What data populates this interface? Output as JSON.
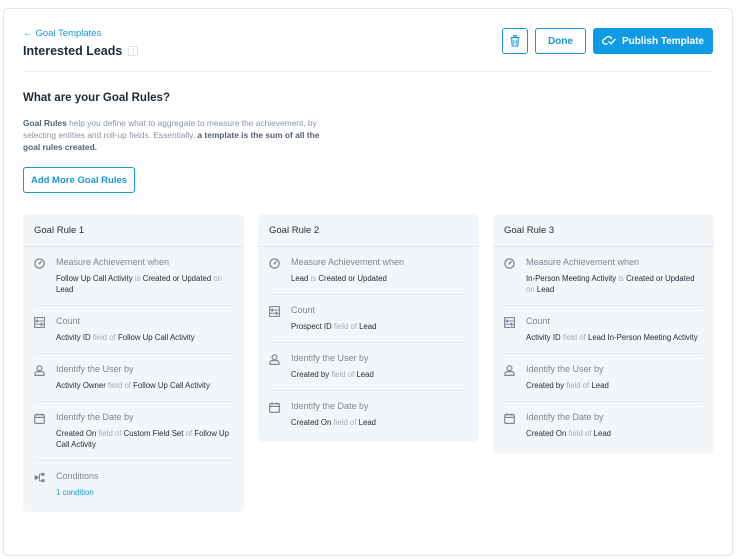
{
  "header": {
    "back_link": "Goal Templates",
    "back_arrow": "←",
    "title": "Interested Leads",
    "buttons": {
      "delete_icon": "trash-icon",
      "done": "Done",
      "publish": "Publish Template",
      "publish_icon": "cloud-check-icon"
    }
  },
  "intro": {
    "heading": "What are your Goal Rules?",
    "desc_bold_1": "Goal Rules",
    "desc_text_1": " help you define what to aggregate to measure the achievement, by selecting entities and roll-up fields. Essentially, ",
    "desc_bold_2": "a template is the sum of all the goal rules created.",
    "add_button": "Add More Goal Rules"
  },
  "labels": {
    "measure": "Measure Achievement when",
    "count": "Count",
    "user": "Identify the User by",
    "date": "Identify the Date by",
    "conditions": "Conditions",
    "is": "is",
    "on": "on",
    "field_of": "field of",
    "of": "of"
  },
  "rules": [
    {
      "title": "Goal Rule 1",
      "measure": {
        "entity": "Follow Up Call Activity",
        "action": "Created or Updated",
        "on": "Lead"
      },
      "count": {
        "field": "Activity ID",
        "of": "Follow Up Call Activity"
      },
      "user": {
        "field": "Activity Owner",
        "of": "Follow Up Call Activity"
      },
      "date": {
        "field": "Created On",
        "of": "Custom Field Set",
        "of2": "Follow Up Call Activity"
      },
      "conditions": "1 condition"
    },
    {
      "title": "Goal Rule 2",
      "measure": {
        "entity": "Lead",
        "action": "Created or Updated"
      },
      "count": {
        "field": "Prospect ID",
        "of": "Lead"
      },
      "user": {
        "field": "Created by",
        "of": "Lead"
      },
      "date": {
        "field": "Created On",
        "of": "Lead"
      }
    },
    {
      "title": "Goal Rule 3",
      "measure": {
        "entity": "In-Person Meeting Activity",
        "action": "Created or Updated",
        "on": "Lead"
      },
      "count": {
        "field": "Activity ID",
        "of": "Lead In-Person Meeting Activity"
      },
      "user": {
        "field": "Created by",
        "of": "Lead"
      },
      "date": {
        "field": "Created On",
        "of": "Lead"
      }
    }
  ],
  "colors": {
    "accent": "#1a96d8",
    "primary_button": "#0f9ae6",
    "card_bg": "#f3f6f9"
  }
}
